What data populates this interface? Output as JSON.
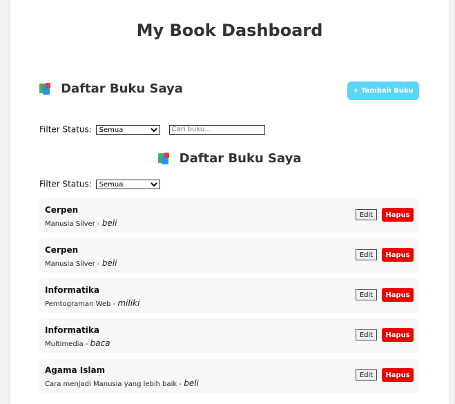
{
  "page_title": "My Book Dashboard",
  "section": {
    "title": "Daftar Buku Saya",
    "icon": "books-icon",
    "add_button": "+ Tambah Buku"
  },
  "filter1": {
    "label": "Filter Status:",
    "selected": "Semua",
    "search_placeholder": "Cari buku..."
  },
  "subsection": {
    "title": "Daftar Buku Saya",
    "icon": "books-icon"
  },
  "filter2": {
    "label": "Filter Status:",
    "selected": "Semua"
  },
  "books": [
    {
      "category": "Cerpen",
      "title": "Manusia Silver",
      "status": "beli"
    },
    {
      "category": "Cerpen",
      "title": "Manusia Silver",
      "status": "beli"
    },
    {
      "category": "Informatika",
      "title": "Pemtograman Web",
      "status": "miliki"
    },
    {
      "category": "Informatika",
      "title": "Multimedia",
      "status": "baca"
    },
    {
      "category": "Agama Islam",
      "title": "Cara menjadi Manusia yang lebih baik",
      "status": "beli"
    }
  ],
  "actions": {
    "edit": "Edit",
    "delete": "Hapus"
  },
  "colors": {
    "accent": "#5bd5f5",
    "danger": "#ee0000"
  }
}
